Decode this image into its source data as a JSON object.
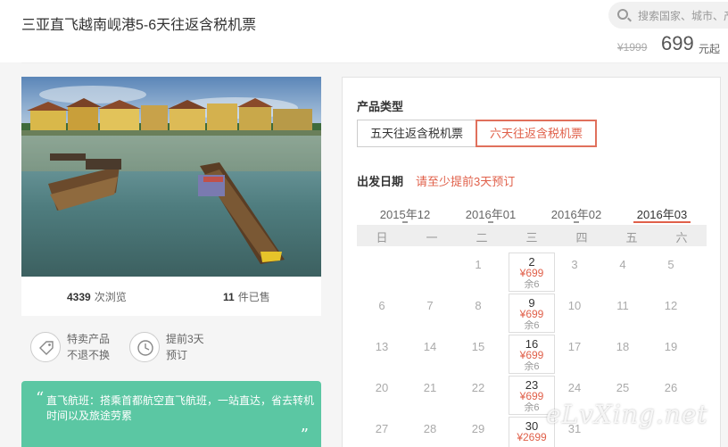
{
  "header": {
    "title": "三亚直飞越南岘港5-6天往返含税机票",
    "search_placeholder": "搜索国家、城市、产",
    "price_old": "¥1999",
    "price_now": "699",
    "price_unit": "元起"
  },
  "stats": {
    "views_count": "4339",
    "views_label": "次浏览",
    "sold_count": "11",
    "sold_label": "件已售"
  },
  "features": [
    {
      "icon": "tag-icon",
      "line1": "特卖产品",
      "line2": "不退不换"
    },
    {
      "icon": "clock-icon",
      "line1": "提前3天",
      "line2": "预订"
    }
  ],
  "quote": {
    "text": "直飞航班：搭乘首都航空直飞航班，一站直达，省去转机时间以及旅途劳累"
  },
  "product": {
    "label": "产品类型",
    "options": [
      "五天往返含税机票",
      "六天往返含税机票"
    ],
    "selected": 1
  },
  "date": {
    "label": "出发日期",
    "hint": "请至少提前3天预订"
  },
  "calendar": {
    "months": [
      "2015年12",
      "2016年01",
      "2016年02",
      "2016年03"
    ],
    "active_month": 3,
    "weekdays": [
      "日",
      "一",
      "二",
      "三",
      "四",
      "五",
      "六"
    ],
    "rows": [
      [
        {
          "d": ""
        },
        {
          "d": ""
        },
        {
          "d": "1"
        },
        {
          "d": "2",
          "price": "¥699",
          "left": "余6"
        },
        {
          "d": "3"
        },
        {
          "d": "4"
        },
        {
          "d": "5"
        }
      ],
      [
        {
          "d": "6"
        },
        {
          "d": "7"
        },
        {
          "d": "8"
        },
        {
          "d": "9",
          "price": "¥699",
          "left": "余6"
        },
        {
          "d": "10"
        },
        {
          "d": "11"
        },
        {
          "d": "12"
        }
      ],
      [
        {
          "d": "13"
        },
        {
          "d": "14"
        },
        {
          "d": "15"
        },
        {
          "d": "16",
          "price": "¥699",
          "left": "余6"
        },
        {
          "d": "17"
        },
        {
          "d": "18"
        },
        {
          "d": "19"
        }
      ],
      [
        {
          "d": "20"
        },
        {
          "d": "21"
        },
        {
          "d": "22"
        },
        {
          "d": "23",
          "price": "¥699",
          "left": "余6"
        },
        {
          "d": "24"
        },
        {
          "d": "25"
        },
        {
          "d": "26"
        }
      ],
      [
        {
          "d": "27"
        },
        {
          "d": "28"
        },
        {
          "d": "29"
        },
        {
          "d": "30",
          "price": "¥2699",
          "left": ""
        },
        {
          "d": "31"
        },
        {
          "d": ""
        },
        {
          "d": ""
        }
      ]
    ]
  },
  "watermark": "eLvXing.net",
  "colors": {
    "accent": "#e0604a",
    "quote_bg": "#5bc7a3"
  }
}
